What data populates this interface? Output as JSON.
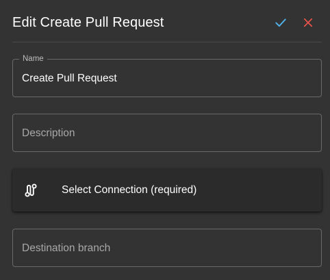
{
  "dialog": {
    "title": "Edit Create Pull Request",
    "confirm_icon": "check-icon",
    "close_icon": "close-icon",
    "colors": {
      "confirm": "#4fb0e8",
      "close": "#e5534b",
      "background": "#333333"
    }
  },
  "fields": {
    "name": {
      "label": "Name",
      "value": "Create Pull Request"
    },
    "description": {
      "placeholder": "Description"
    },
    "connection": {
      "label": "Select Connection (required)",
      "icon": "connection-icon"
    },
    "destination_branch": {
      "placeholder": "Destination branch"
    }
  }
}
